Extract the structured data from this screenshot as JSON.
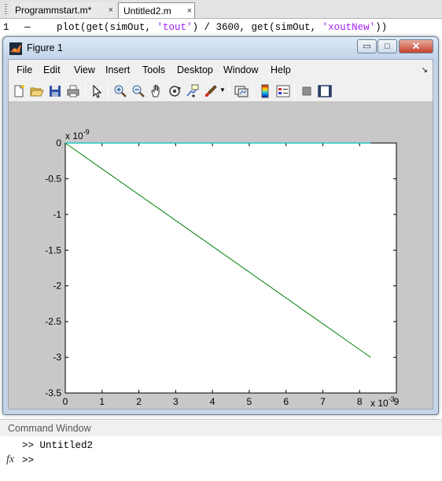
{
  "editor": {
    "tabs": [
      {
        "label": "Programmstart.m*",
        "close": "×",
        "active": false
      },
      {
        "label": "Untitled2.m",
        "close": "×",
        "active": true
      }
    ],
    "line_number": "1",
    "line_marker": "—",
    "code": {
      "p1": "plot(get(simOut, ",
      "s1": "'tout'",
      "p2": ") / 3600, get(simOut, ",
      "s2": "'xoutNew'",
      "p3": "))"
    }
  },
  "figure": {
    "title": "Figure 1",
    "controls": {
      "minimize": "▭",
      "maximize": "□",
      "close": "✕"
    },
    "menu": [
      "File",
      "Edit",
      "View",
      "Insert",
      "Tools",
      "Desktop",
      "Window",
      "Help"
    ],
    "menu_grip": "↘",
    "toolbar_icons": [
      "new-figure-icon",
      "open-file-icon",
      "save-icon",
      "print-icon",
      "pointer-icon",
      "zoom-in-icon",
      "zoom-out-icon",
      "pan-icon",
      "rotate-3d-icon",
      "data-cursor-icon",
      "brush-icon",
      "link-plot-icon",
      "colorbar-icon",
      "legend-icon",
      "hide-plot-tools-icon",
      "show-plot-tools-icon"
    ]
  },
  "chart_data": {
    "type": "line",
    "title": "",
    "xlabel": "",
    "ylabel": "",
    "x_exponent_label": "x 10",
    "x_exponent": "-3",
    "y_exponent_label": "x 10",
    "y_exponent": "-9",
    "xlim": [
      0,
      9
    ],
    "ylim": [
      -3.5,
      0
    ],
    "xticks": [
      "0",
      "1",
      "2",
      "3",
      "4",
      "5",
      "6",
      "7",
      "8",
      "9"
    ],
    "yticks": [
      "0",
      "-0.5",
      "-1",
      "-1.5",
      "-2",
      "-2.5",
      "-3",
      "-3.5"
    ],
    "grid": false,
    "series": [
      {
        "color": "#008000",
        "x": [
          0,
          8.3
        ],
        "y": [
          0,
          -3.0
        ]
      },
      {
        "color": "#00bfbf",
        "x": [
          0,
          8.3
        ],
        "y": [
          0,
          0
        ]
      }
    ]
  },
  "command_window": {
    "header": "Command Window",
    "lines": [
      ">> Untitled2",
      ">> "
    ],
    "fx_label": "fx"
  }
}
